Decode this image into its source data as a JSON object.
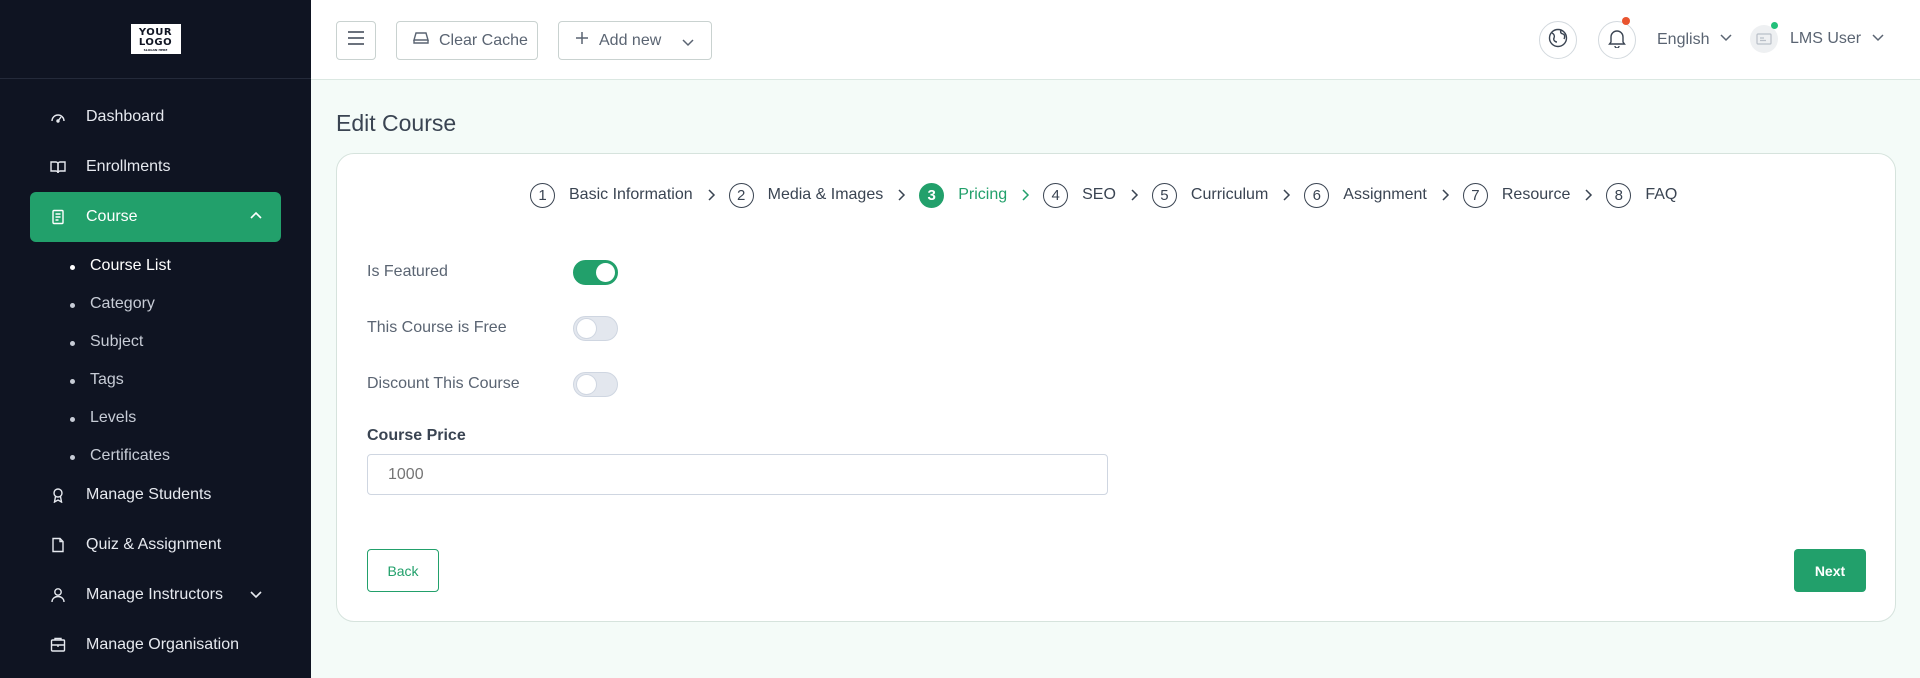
{
  "logo": {
    "line1": "YOUR",
    "line2": "LOGO",
    "tagline": "SLOGAN HERE"
  },
  "sidebar": {
    "items": [
      {
        "label": "Dashboard",
        "icon": "gauge-icon"
      },
      {
        "label": "Enrollments",
        "icon": "book-open-icon"
      },
      {
        "label": "Course",
        "icon": "document-icon",
        "active": true
      },
      {
        "label": "Manage Students",
        "icon": "award-icon"
      },
      {
        "label": "Quiz & Assignment",
        "icon": "file-icon"
      },
      {
        "label": "Manage Instructors",
        "icon": "user-icon"
      },
      {
        "label": "Manage Organisation",
        "icon": "building-icon"
      }
    ],
    "course_sub": [
      "Course List",
      "Category",
      "Subject",
      "Tags",
      "Levels",
      "Certificates"
    ]
  },
  "topbar": {
    "clear_cache": "Clear Cache",
    "add_new": "Add new",
    "language": "English",
    "user_name": "LMS User"
  },
  "page": {
    "title": "Edit Course",
    "steps": [
      {
        "num": "1",
        "label": "Basic Information"
      },
      {
        "num": "2",
        "label": "Media & Images"
      },
      {
        "num": "3",
        "label": "Pricing",
        "active": true
      },
      {
        "num": "4",
        "label": "SEO"
      },
      {
        "num": "5",
        "label": "Curriculum"
      },
      {
        "num": "6",
        "label": "Assignment"
      },
      {
        "num": "7",
        "label": "Resource"
      },
      {
        "num": "8",
        "label": "FAQ"
      }
    ],
    "fields": {
      "is_featured": {
        "label": "Is Featured",
        "on": true
      },
      "is_free": {
        "label": "This Course is Free",
        "on": false
      },
      "discount": {
        "label": "Discount This Course",
        "on": false
      },
      "price_label": "Course Price",
      "price_placeholder": "1000"
    },
    "back": "Back",
    "next": "Next"
  },
  "colors": {
    "accent": "#22a06b",
    "sidebar_bg": "#0f1422",
    "notification": "#e9542f",
    "online": "#22c07a"
  }
}
